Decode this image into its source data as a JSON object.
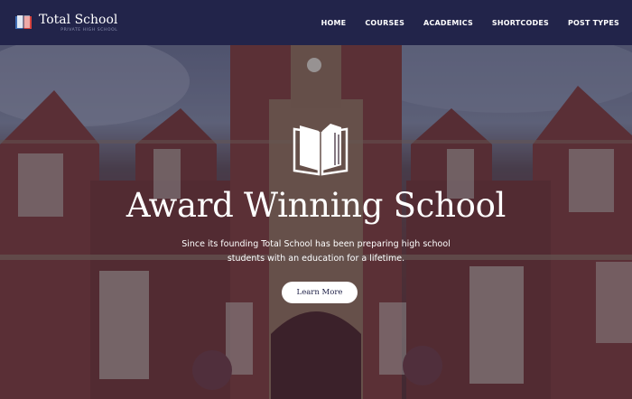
{
  "header": {
    "brand_name": "Total School",
    "brand_tagline": "PRIVATE HIGH SCHOOL",
    "nav": [
      "HOME",
      "COURSES",
      "ACADEMICS",
      "SHORTCODES",
      "POST TYPES"
    ]
  },
  "hero": {
    "icon": "open-book-icon",
    "title": "Award Winning School",
    "subtitle": "Since its founding Total School has been preparing high school students with an education for a lifetime.",
    "cta_label": "Learn More"
  },
  "colors": {
    "header_bg": "#22244a",
    "brand_red": "#d9443f",
    "brand_blue": "#3f6db4",
    "cta_bg": "#ffffff"
  }
}
